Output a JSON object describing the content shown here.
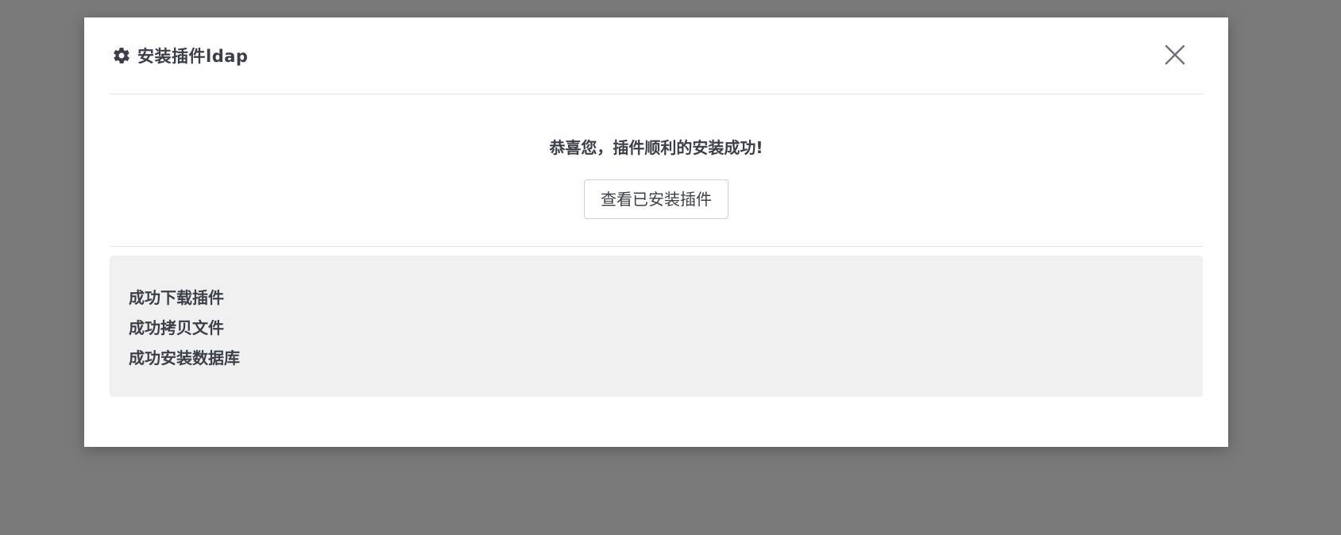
{
  "modal": {
    "title": "安装插件ldap",
    "icon": "gear-icon",
    "close_icon": "close-icon"
  },
  "success": {
    "message": "恭喜您，插件顺利的安装成功!",
    "view_button_label": "查看已安装插件"
  },
  "log": {
    "lines": [
      "成功下载插件",
      "成功拷贝文件",
      "成功安装数据库"
    ]
  }
}
